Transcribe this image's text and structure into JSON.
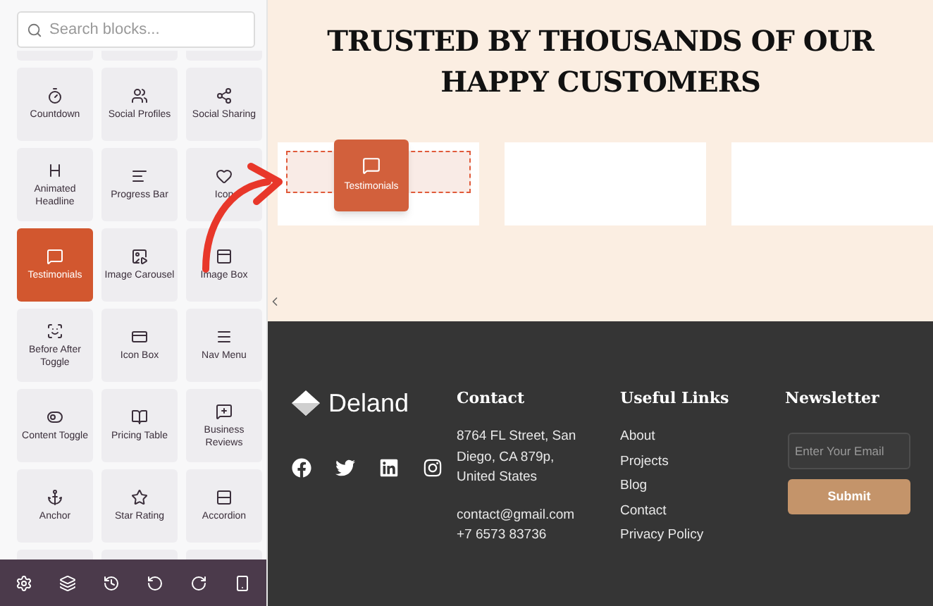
{
  "sidebar": {
    "search": {
      "placeholder": "Search blocks..."
    },
    "blocks": [
      {
        "label": "Countdown",
        "selected": false
      },
      {
        "label": "Social Profiles",
        "selected": false
      },
      {
        "label": "Social Sharing",
        "selected": false
      },
      {
        "label": "Animated Headline",
        "selected": false
      },
      {
        "label": "Progress Bar",
        "selected": false
      },
      {
        "label": "Icon",
        "selected": false
      },
      {
        "label": "Testimonials",
        "selected": true
      },
      {
        "label": "Image Carousel",
        "selected": false
      },
      {
        "label": "Image Box",
        "selected": false
      },
      {
        "label": "Before After Toggle",
        "selected": false
      },
      {
        "label": "Icon Box",
        "selected": false
      },
      {
        "label": "Nav Menu",
        "selected": false
      },
      {
        "label": "Content Toggle",
        "selected": false
      },
      {
        "label": "Pricing Table",
        "selected": false
      },
      {
        "label": "Business Reviews",
        "selected": false
      },
      {
        "label": "Anchor",
        "selected": false
      },
      {
        "label": "Star Rating",
        "selected": false
      },
      {
        "label": "Accordion",
        "selected": false
      }
    ]
  },
  "canvas": {
    "heading": "TRUSTED BY THOUSANDS OF OUR HAPPY CUSTOMERS",
    "dragged_block": {
      "label": "Testimonials"
    }
  },
  "footer": {
    "brand": "Deland",
    "contact": {
      "title": "Contact",
      "address": "8764 FL Street, San Diego, CA 879p, United States",
      "email": "contact@gmail.com",
      "phone": "+7 6573 83736"
    },
    "links": {
      "title": "Useful Links",
      "items": [
        "About",
        "Projects",
        "Blog",
        "Contact",
        "Privacy Policy"
      ]
    },
    "newsletter": {
      "title": "Newsletter",
      "placeholder": "Enter Your Email",
      "button": "Submit"
    }
  }
}
